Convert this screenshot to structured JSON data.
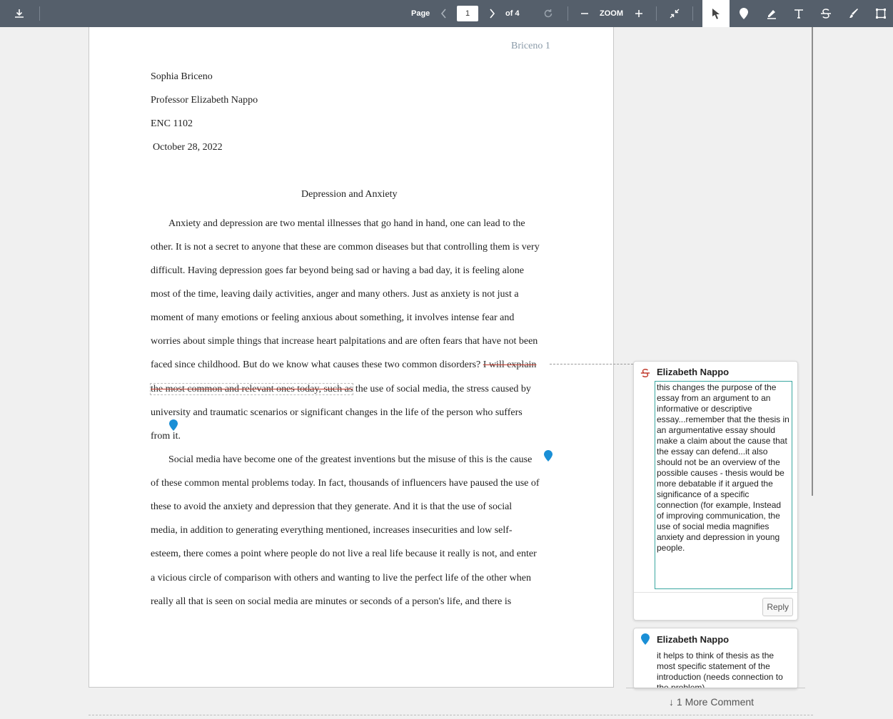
{
  "toolbar": {
    "page_label": "Page",
    "page_value": "1",
    "of_label": "of 4",
    "zoom_label": "ZOOM"
  },
  "document": {
    "running_head": "Briceno 1",
    "author": "Sophia Briceno",
    "professor": "Professor Elizabeth Nappo",
    "course": "ENC 1102",
    "date": "October 28, 2022",
    "title": "Depression and Anxiety",
    "lines": [
      "Anxiety and depression are two mental illnesses that go hand in hand, one can lead to the",
      "other. It is not a secret to anyone that these are common diseases but that controlling them is very",
      "difficult. Having depression goes far beyond being sad or having a bad day, it is feeling alone",
      "most of the time, leaving daily activities, anger and many others. Just as anxiety is not just a",
      "moment of many emotions or feeling anxious about something, it involves intense fear and",
      "worries about simple things that increase heart palpitations and are often fears that have not been"
    ],
    "line7_pre": "faced since childhood. But do we know what causes these two common disorders? ",
    "line7_strike": "I will explain",
    "line8_strike": "the most common and relevant ones today, such as",
    "line8_post": " the use of social media, the stress caused by",
    "lines_b": [
      "university and traumatic scenarios or significant changes in the life of the person who suffers",
      "from it."
    ],
    "para2_first": "Social media have become one of the greatest inventions but the misuse of this is the cause",
    "lines_c": [
      "of these common mental problems today. In fact, thousands of influencers have paused the use of",
      "these to avoid the anxiety and depression that they generate. And it is that the use of social",
      "media, in addition to generating everything mentioned, increases insecurities and low self-",
      "esteem, there comes a point where people do not live a real life because it really is not, and enter",
      "a vicious circle of comparison with others and wanting to live the perfect life of the other when",
      "really all that is seen on social media are minutes or seconds of a person's life, and there is"
    ]
  },
  "comments": [
    {
      "author": "Elizabeth Nappo",
      "text": "this changes the purpose of the essay from an argument to an informative or descriptive essay...remember that the thesis in an argumentative essay should make a claim about the cause that the essay can defend...it also should not be an overview of the possible causes - thesis would be more debatable if it argued the significance of a specific connection (for example, Instead of improving communication, the use of social media magnifies anxiety and depression in young people.",
      "reply_label": "Reply"
    },
    {
      "author": "Elizabeth Nappo",
      "text": "it helps to think of thesis as the most specific statement of the introduction (needs connection to the problem)"
    }
  ],
  "more_comments": "1 More Comment",
  "colors": {
    "toolbar": "#555f6b",
    "pin": "#1a8fd6",
    "strike": "#c0392b",
    "focus": "#3aa6a0"
  }
}
